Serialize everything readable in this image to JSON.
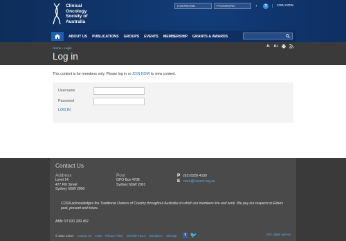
{
  "header": {
    "logo_lines": [
      "Clinical",
      "Oncology",
      "Society of",
      "Australia"
    ],
    "username_placeholder": "USERNAME",
    "password_placeholder": "PASSWORD",
    "go_icon": "arrow-right-icon",
    "help_icon": "question-icon",
    "join_label": "JOIN NOW"
  },
  "nav": {
    "home_icon": "home-icon",
    "items": [
      "ABOUT US",
      "PUBLICATIONS",
      "GROUPS",
      "EVENTS",
      "MEMBERSHIP",
      "GRANTS & AWARDS"
    ],
    "search_icon": "search-icon"
  },
  "title_band": {
    "breadcrumb_home": "Home",
    "breadcrumb_sep": "›",
    "breadcrumb_current": "Login",
    "title": "Log in",
    "tools": [
      "A-",
      "A+"
    ],
    "tool_icons": [
      "print-icon",
      "rss-icon"
    ]
  },
  "content": {
    "notice_before": "This content is for members only. Please log in or",
    "notice_link": "JOIN NOW",
    "notice_after": "to view content.",
    "username_label": "Username",
    "password_label": "Password",
    "login_label": "LOG IN"
  },
  "footer": {
    "heading": "Contact Us",
    "address_heading": "Address",
    "address_lines": [
      "Level 14",
      "477 Pitt Street",
      "Sydney NSW 2000"
    ],
    "post_heading": "Post",
    "post_lines": [
      "GPO Box 4708",
      "Sydney NSW 2001"
    ],
    "phone_prefix": "P",
    "phone": "(02) 8256 4100",
    "email_prefix": "E",
    "email": "cosa@cancer.org.au",
    "acknowledgement": "COSA acknowledges the Traditional Owners of Country throughout Australia on which our members live and work. We pay our respects to Elders past, present and future.",
    "abn": "ABN: 97 631 209 452",
    "copyright": "© 2022 COSA",
    "bottom_links": [
      "Contact Us",
      "Links",
      "Privacy Policy",
      "Website T&C's",
      "Disclaimer",
      "Sitemap"
    ],
    "credit": "Site: digital agency"
  },
  "colors": {
    "header_bg": "#123c78",
    "dark_band": "#3a3a3a",
    "link": "#1d6fc2"
  }
}
